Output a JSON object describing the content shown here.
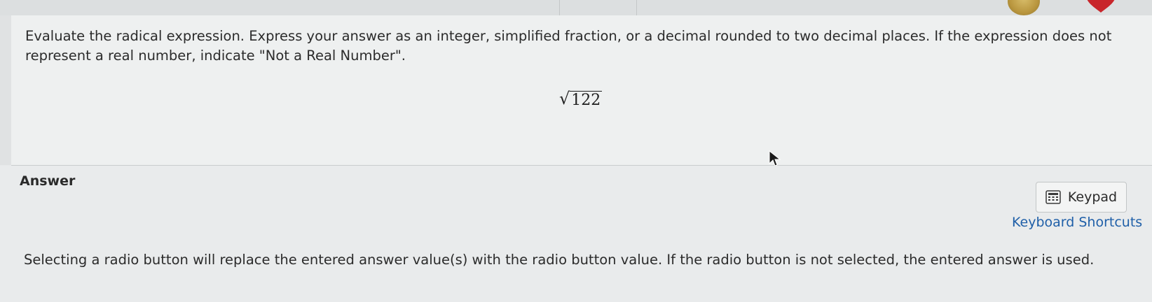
{
  "question": {
    "prompt": "Evaluate the radical expression. Express your answer as an integer, simplified fraction, or a decimal rounded to two decimal places. If the expression does not represent a real number, indicate \"Not a Real Number\".",
    "expression": {
      "radical": "√",
      "radicand": "122"
    }
  },
  "answer": {
    "label": "Answer",
    "keypad_label": "Keypad",
    "shortcuts_label": "Keyboard Shortcuts",
    "radio_note": "Selecting a radio button will replace the entered answer value(s) with the radio button value. If the radio button is not selected, the entered answer is used."
  },
  "icons": {
    "keypad": "keypad-icon",
    "coin": "coin-icon",
    "heart": "heart-icon",
    "cursor": "cursor-icon"
  },
  "colors": {
    "link": "#1f5fa8",
    "heart": "#c8262b",
    "coin": "#b9963e"
  }
}
